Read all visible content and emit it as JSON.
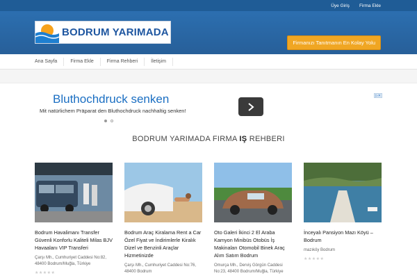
{
  "topbar": {
    "links": [
      "Üye Giriş",
      "Firma Ekle"
    ]
  },
  "header": {
    "logo_text": "BODRUM YARIMADA",
    "cta_label": "Firmanızı Tanıtmanın En Kolay Yolu"
  },
  "nav": {
    "items": [
      "Ana Sayfa",
      "Firma Ekle",
      "Firma Rehberi",
      "İletişim"
    ]
  },
  "ad": {
    "title": "Bluthochdruck senken",
    "text": "Mit natürlichem Präparat den Bluthochdruck nachhaltig senken!"
  },
  "section": {
    "title_pre": "BODRUM YARIMADA FIRMA ",
    "title_bold": "IŞ",
    "title_post": " REHBERI"
  },
  "cards": [
    {
      "title": "Bodrum Havalimanı Transfer Güvenli Konforlu Kaliteli Milas BJV Havaalanı VIP Transferi",
      "address": "Çarşı Mh., Cumhuriyet Caddesi No:82, 48400 Bodrum/Muğla, Türkiye"
    },
    {
      "title": "Bodrum Araç Kiralama Rent a Car Özel Fiyat ve İndirimlerle Kiralık Dizel ve Benzinli Araçlar Hizmetinizde",
      "address": "Çarşı Mh., Cumhuriyet Caddesi No:76, 48400 Bodrum"
    },
    {
      "title": "Oto Galeri İkinci 2 El Araba Kamyon Minibüs Otobüs İş Makinaları Otomobil Binek Araç Alım Satım Bodrum",
      "address": "Omurça Mh., Derviş Görgün Caddesi No:23, 48400 Bodrum/Muğla, Türkiye"
    },
    {
      "title": "İnceyalı Pansiyon Mazı Köyü – Bodrum",
      "address": "mazıköy Bodrum"
    }
  ],
  "colors": {
    "topbar": "#1f5c96",
    "header": "#2c6fb0",
    "cta": "#f0a623",
    "ad_title": "#1a6ec2"
  }
}
